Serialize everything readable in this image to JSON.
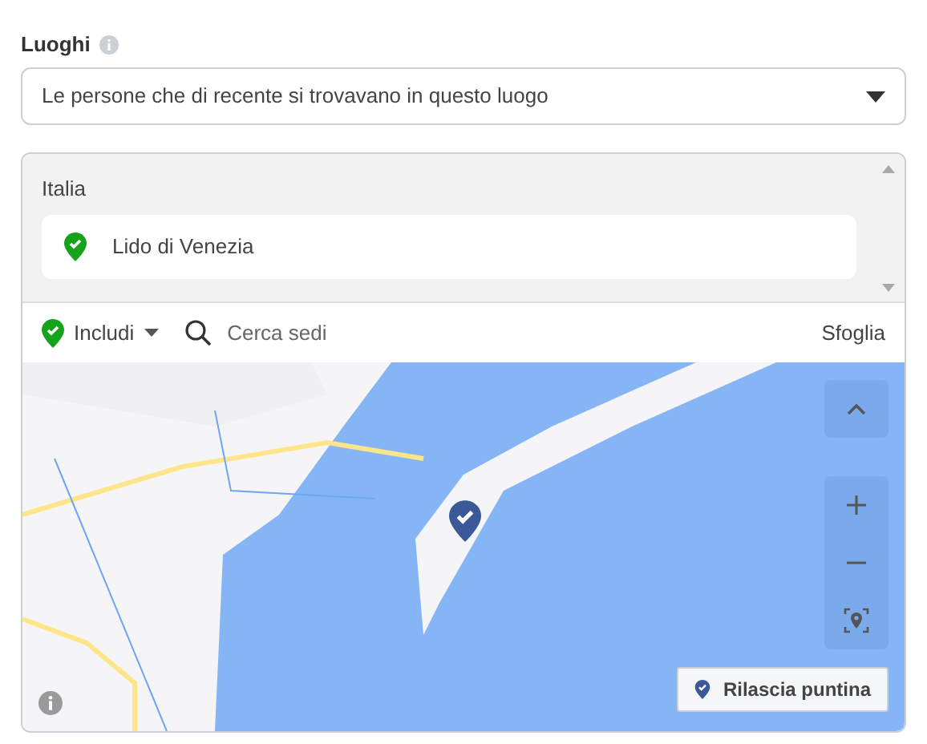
{
  "section": {
    "title": "Luoghi"
  },
  "audience_select": {
    "value": "Le persone che di recente si trovavano in questo luogo"
  },
  "locations": {
    "country": "Italia",
    "items": [
      {
        "name": "Lido di Venezia",
        "kind": "included"
      }
    ]
  },
  "toolbar": {
    "mode": "Includi",
    "search_placeholder": "Cerca sedi",
    "browse": "Sfoglia"
  },
  "map": {
    "drop_pin_button": "Rilascia puntina"
  }
}
